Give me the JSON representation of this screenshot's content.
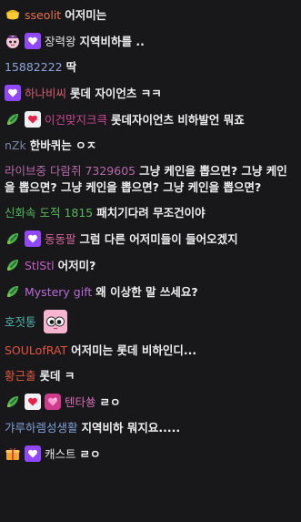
{
  "colors": {
    "background": "#18181b",
    "message_text": "#efeff1",
    "sub_badge": "#9147ff"
  },
  "messages": [
    {
      "badges": [
        "cheese-cup-badge"
      ],
      "user": "sseolit",
      "color": "#e8734a",
      "text": "어저미는"
    },
    {
      "badges": [
        "face-badge",
        "sub-badge"
      ],
      "user": "장력왕",
      "color": "#e5e5e5",
      "text": "지역비하를 .."
    },
    {
      "badges": [],
      "user": "15882222",
      "color": "#8ea4d8",
      "text": "딱"
    },
    {
      "badges": [
        "sub-badge"
      ],
      "user": "하나비씨",
      "color": "#d45d73",
      "text": "롯데 자이언츠 ㅋㅋ"
    },
    {
      "badges": [
        "leaf-badge",
        "heart-badge"
      ],
      "user": "이건맞지크큭",
      "color": "#c9478f",
      "text": "롯데자이언츠 비하발언 뭐죠"
    },
    {
      "badges": [],
      "user": "nZk",
      "color": "#7b86a0",
      "text": "한바퀴는 ㅇㅈ"
    },
    {
      "badges": [],
      "user": "라이브중 다람쥐 7329605",
      "color": "#b46aa7",
      "text": "그냥 케인을 뽑으면? 그냥 케인을 뽑으면? 그냥 케인을 뽑으면? 그냥 케인을 뽑으면?"
    },
    {
      "badges": [],
      "user": "신화속 도적 1815",
      "color": "#54b85a",
      "text": "패치기다려 무조건이야"
    },
    {
      "badges": [
        "leaf-badge",
        "sub-badge"
      ],
      "user": "동동팔",
      "color": "#d2649c",
      "text": "그럼 다른 어저미들이 들어오겠지"
    },
    {
      "badges": [
        "leaf-badge"
      ],
      "user": "StlStl",
      "color": "#c35fc1",
      "text": "어저미?"
    },
    {
      "badges": [
        "leaf-badge"
      ],
      "user": "Mystery gift",
      "color": "#b86ad6",
      "text": "왜 이상한 말 쓰세요?"
    },
    {
      "badges": [],
      "user": "호젓통",
      "color": "#4fb4aa",
      "text": "",
      "emote": "pink-face-emote"
    },
    {
      "badges": [],
      "user": "SOULofRAT",
      "color": "#e3533f",
      "text": "어저미는 롯데 비하인디..."
    },
    {
      "badges": [],
      "user": "황근출",
      "color": "#e25a3c",
      "text": "롯데 ㅋ"
    },
    {
      "badges": [
        "leaf-badge",
        "heart-badge",
        "gift-badge"
      ],
      "user": "텐타쑝",
      "color": "#d36fb4",
      "text": "ㄹㅇ"
    },
    {
      "badges": [],
      "user": "갸루하렘성생활",
      "color": "#7fa0d6",
      "text": "지역비하 뭐지요....."
    },
    {
      "badges": [
        "gift-box-badge",
        "sub-badge"
      ],
      "user": "캐스트",
      "color": "#e8e8e8",
      "text": "ㄹㅇ"
    }
  ]
}
